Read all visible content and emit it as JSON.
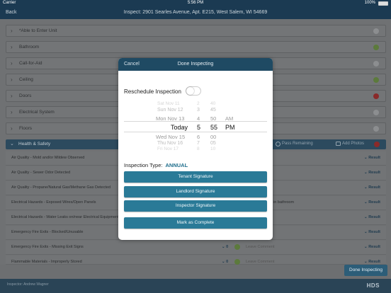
{
  "status_bar": {
    "carrier": "Carrier",
    "time": "5:56 PM",
    "battery": "100%"
  },
  "nav": {
    "back": "Back",
    "title": "Inspect: 2901 Searles Avenue, Apt. E215, West Salem, WI 54669"
  },
  "sections": [
    {
      "label": "*Able to Enter Unit",
      "status": "empty"
    },
    {
      "label": "Bathroom",
      "status": "ok"
    },
    {
      "label": "Call-for-Aid",
      "status": "empty"
    },
    {
      "label": "Ceiling",
      "status": "ok"
    },
    {
      "label": "Doors",
      "status": "fail"
    },
    {
      "label": "Electrical System",
      "status": "empty"
    },
    {
      "label": "Floors",
      "status": "empty"
    }
  ],
  "health_safety": {
    "label": "Health & Safety",
    "pass_remaining": "Pass Remaining",
    "add_photos": "Add Photos"
  },
  "rows": [
    {
      "label": "Air Quality - Mold and/or Mildew Observed",
      "result": "Result",
      "count": "",
      "comment": "",
      "note": ""
    },
    {
      "label": "Air Quality - Sewer Odor Detected",
      "result": "Result",
      "count": "",
      "comment": "",
      "note": ""
    },
    {
      "label": "Air Quality - Propane/Natural Gas/Methane Gas Detected",
      "result": "Result",
      "count": "",
      "comment": "",
      "note": ""
    },
    {
      "label": "Electrical Hazards - Exposed Wires/Open Panels",
      "result": "Result",
      "count": "",
      "comment": "",
      "note": "in bathroom"
    },
    {
      "label": "Electrical Hazards - Water Leaks on/near Electrical Equipment",
      "result": "Result",
      "count": "",
      "comment": "",
      "note": ""
    },
    {
      "label": "Emergency Fire Exits - Blocked/Unusable",
      "result": "Result",
      "count": "",
      "comment": "",
      "note": ""
    },
    {
      "label": "Emergency Fire Exits - Missing Exit Signs",
      "result": "Result",
      "count": "0",
      "comment": "Leave Comment",
      "note": ""
    },
    {
      "label": "Flammable Materials - Improperly Stored",
      "result": "Result",
      "count": "0",
      "comment": "Leave Comment",
      "note": ""
    }
  ],
  "done_button": "Done Inspecting",
  "footer": {
    "inspector": "Inspector: Andrew Wagner",
    "logo": "HDS"
  },
  "modal": {
    "cancel": "Cancel",
    "title": "Done Inspecting",
    "reschedule_label": "Reschedule Inspection",
    "reschedule_on": false,
    "picker": {
      "dates": [
        "Sat Nov 11",
        "Sun Nov 12",
        "Mon Nov 13",
        "Today",
        "Wed Nov 15",
        "Thu Nov 16",
        "Fri Nov 17"
      ],
      "hours": [
        "2",
        "3",
        "4",
        "5",
        "6",
        "7",
        "8"
      ],
      "minutes": [
        "40",
        "45",
        "50",
        "55",
        "00",
        "05",
        "10"
      ],
      "ampm": [
        "AM",
        "PM"
      ],
      "selected": {
        "date": "Today",
        "hour": "5",
        "minute": "55",
        "ampm": "PM"
      }
    },
    "inspection_type_label": "Inspection Type:",
    "inspection_type_value": "ANNUAL",
    "buttons": {
      "tenant": "Tenant Signature",
      "landlord": "Landlord Signature",
      "inspector": "Inspector Signature",
      "complete": "Mark as Complete"
    }
  },
  "colors": {
    "nav": "#1b3a52",
    "accent": "#2a7a97",
    "ok": "#5c7a3c",
    "fail": "#8a2a2a"
  }
}
